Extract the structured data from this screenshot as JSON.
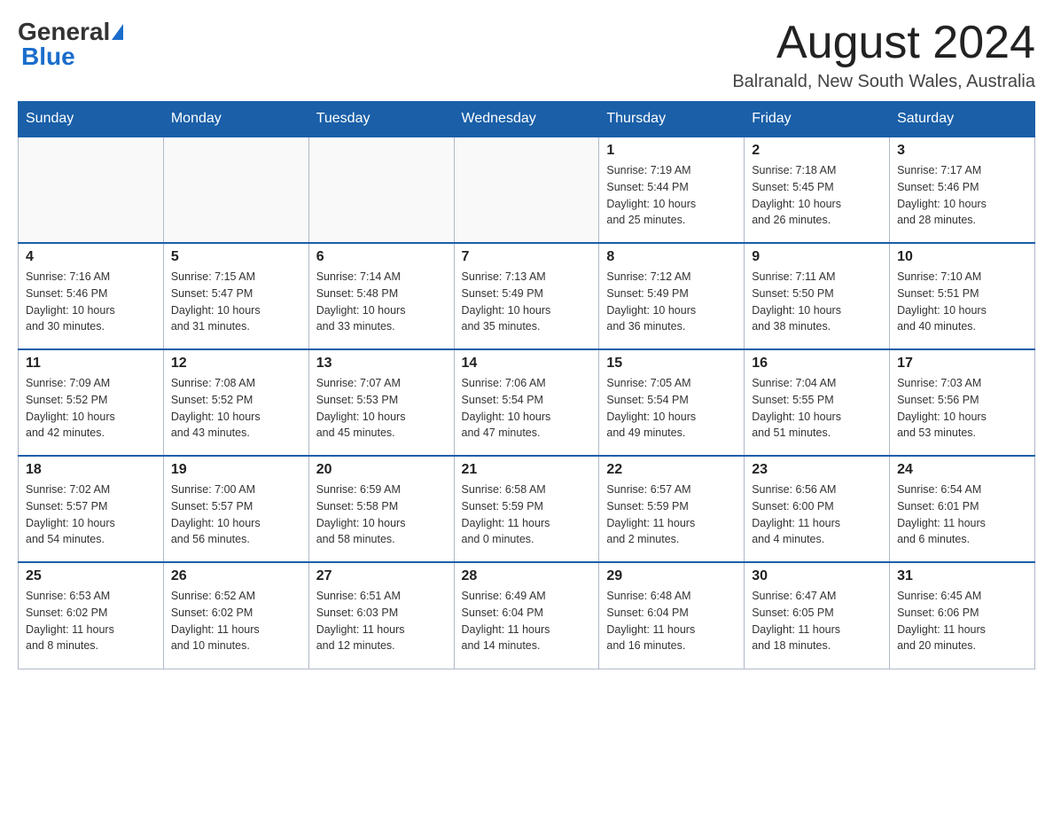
{
  "header": {
    "logo": {
      "general": "General",
      "blue": "Blue"
    },
    "month_year": "August 2024",
    "location": "Balranald, New South Wales, Australia"
  },
  "days_of_week": [
    "Sunday",
    "Monday",
    "Tuesday",
    "Wednesday",
    "Thursday",
    "Friday",
    "Saturday"
  ],
  "weeks": [
    [
      {
        "day": "",
        "info": ""
      },
      {
        "day": "",
        "info": ""
      },
      {
        "day": "",
        "info": ""
      },
      {
        "day": "",
        "info": ""
      },
      {
        "day": "1",
        "info": "Sunrise: 7:19 AM\nSunset: 5:44 PM\nDaylight: 10 hours\nand 25 minutes."
      },
      {
        "day": "2",
        "info": "Sunrise: 7:18 AM\nSunset: 5:45 PM\nDaylight: 10 hours\nand 26 minutes."
      },
      {
        "day": "3",
        "info": "Sunrise: 7:17 AM\nSunset: 5:46 PM\nDaylight: 10 hours\nand 28 minutes."
      }
    ],
    [
      {
        "day": "4",
        "info": "Sunrise: 7:16 AM\nSunset: 5:46 PM\nDaylight: 10 hours\nand 30 minutes."
      },
      {
        "day": "5",
        "info": "Sunrise: 7:15 AM\nSunset: 5:47 PM\nDaylight: 10 hours\nand 31 minutes."
      },
      {
        "day": "6",
        "info": "Sunrise: 7:14 AM\nSunset: 5:48 PM\nDaylight: 10 hours\nand 33 minutes."
      },
      {
        "day": "7",
        "info": "Sunrise: 7:13 AM\nSunset: 5:49 PM\nDaylight: 10 hours\nand 35 minutes."
      },
      {
        "day": "8",
        "info": "Sunrise: 7:12 AM\nSunset: 5:49 PM\nDaylight: 10 hours\nand 36 minutes."
      },
      {
        "day": "9",
        "info": "Sunrise: 7:11 AM\nSunset: 5:50 PM\nDaylight: 10 hours\nand 38 minutes."
      },
      {
        "day": "10",
        "info": "Sunrise: 7:10 AM\nSunset: 5:51 PM\nDaylight: 10 hours\nand 40 minutes."
      }
    ],
    [
      {
        "day": "11",
        "info": "Sunrise: 7:09 AM\nSunset: 5:52 PM\nDaylight: 10 hours\nand 42 minutes."
      },
      {
        "day": "12",
        "info": "Sunrise: 7:08 AM\nSunset: 5:52 PM\nDaylight: 10 hours\nand 43 minutes."
      },
      {
        "day": "13",
        "info": "Sunrise: 7:07 AM\nSunset: 5:53 PM\nDaylight: 10 hours\nand 45 minutes."
      },
      {
        "day": "14",
        "info": "Sunrise: 7:06 AM\nSunset: 5:54 PM\nDaylight: 10 hours\nand 47 minutes."
      },
      {
        "day": "15",
        "info": "Sunrise: 7:05 AM\nSunset: 5:54 PM\nDaylight: 10 hours\nand 49 minutes."
      },
      {
        "day": "16",
        "info": "Sunrise: 7:04 AM\nSunset: 5:55 PM\nDaylight: 10 hours\nand 51 minutes."
      },
      {
        "day": "17",
        "info": "Sunrise: 7:03 AM\nSunset: 5:56 PM\nDaylight: 10 hours\nand 53 minutes."
      }
    ],
    [
      {
        "day": "18",
        "info": "Sunrise: 7:02 AM\nSunset: 5:57 PM\nDaylight: 10 hours\nand 54 minutes."
      },
      {
        "day": "19",
        "info": "Sunrise: 7:00 AM\nSunset: 5:57 PM\nDaylight: 10 hours\nand 56 minutes."
      },
      {
        "day": "20",
        "info": "Sunrise: 6:59 AM\nSunset: 5:58 PM\nDaylight: 10 hours\nand 58 minutes."
      },
      {
        "day": "21",
        "info": "Sunrise: 6:58 AM\nSunset: 5:59 PM\nDaylight: 11 hours\nand 0 minutes."
      },
      {
        "day": "22",
        "info": "Sunrise: 6:57 AM\nSunset: 5:59 PM\nDaylight: 11 hours\nand 2 minutes."
      },
      {
        "day": "23",
        "info": "Sunrise: 6:56 AM\nSunset: 6:00 PM\nDaylight: 11 hours\nand 4 minutes."
      },
      {
        "day": "24",
        "info": "Sunrise: 6:54 AM\nSunset: 6:01 PM\nDaylight: 11 hours\nand 6 minutes."
      }
    ],
    [
      {
        "day": "25",
        "info": "Sunrise: 6:53 AM\nSunset: 6:02 PM\nDaylight: 11 hours\nand 8 minutes."
      },
      {
        "day": "26",
        "info": "Sunrise: 6:52 AM\nSunset: 6:02 PM\nDaylight: 11 hours\nand 10 minutes."
      },
      {
        "day": "27",
        "info": "Sunrise: 6:51 AM\nSunset: 6:03 PM\nDaylight: 11 hours\nand 12 minutes."
      },
      {
        "day": "28",
        "info": "Sunrise: 6:49 AM\nSunset: 6:04 PM\nDaylight: 11 hours\nand 14 minutes."
      },
      {
        "day": "29",
        "info": "Sunrise: 6:48 AM\nSunset: 6:04 PM\nDaylight: 11 hours\nand 16 minutes."
      },
      {
        "day": "30",
        "info": "Sunrise: 6:47 AM\nSunset: 6:05 PM\nDaylight: 11 hours\nand 18 minutes."
      },
      {
        "day": "31",
        "info": "Sunrise: 6:45 AM\nSunset: 6:06 PM\nDaylight: 11 hours\nand 20 minutes."
      }
    ]
  ]
}
